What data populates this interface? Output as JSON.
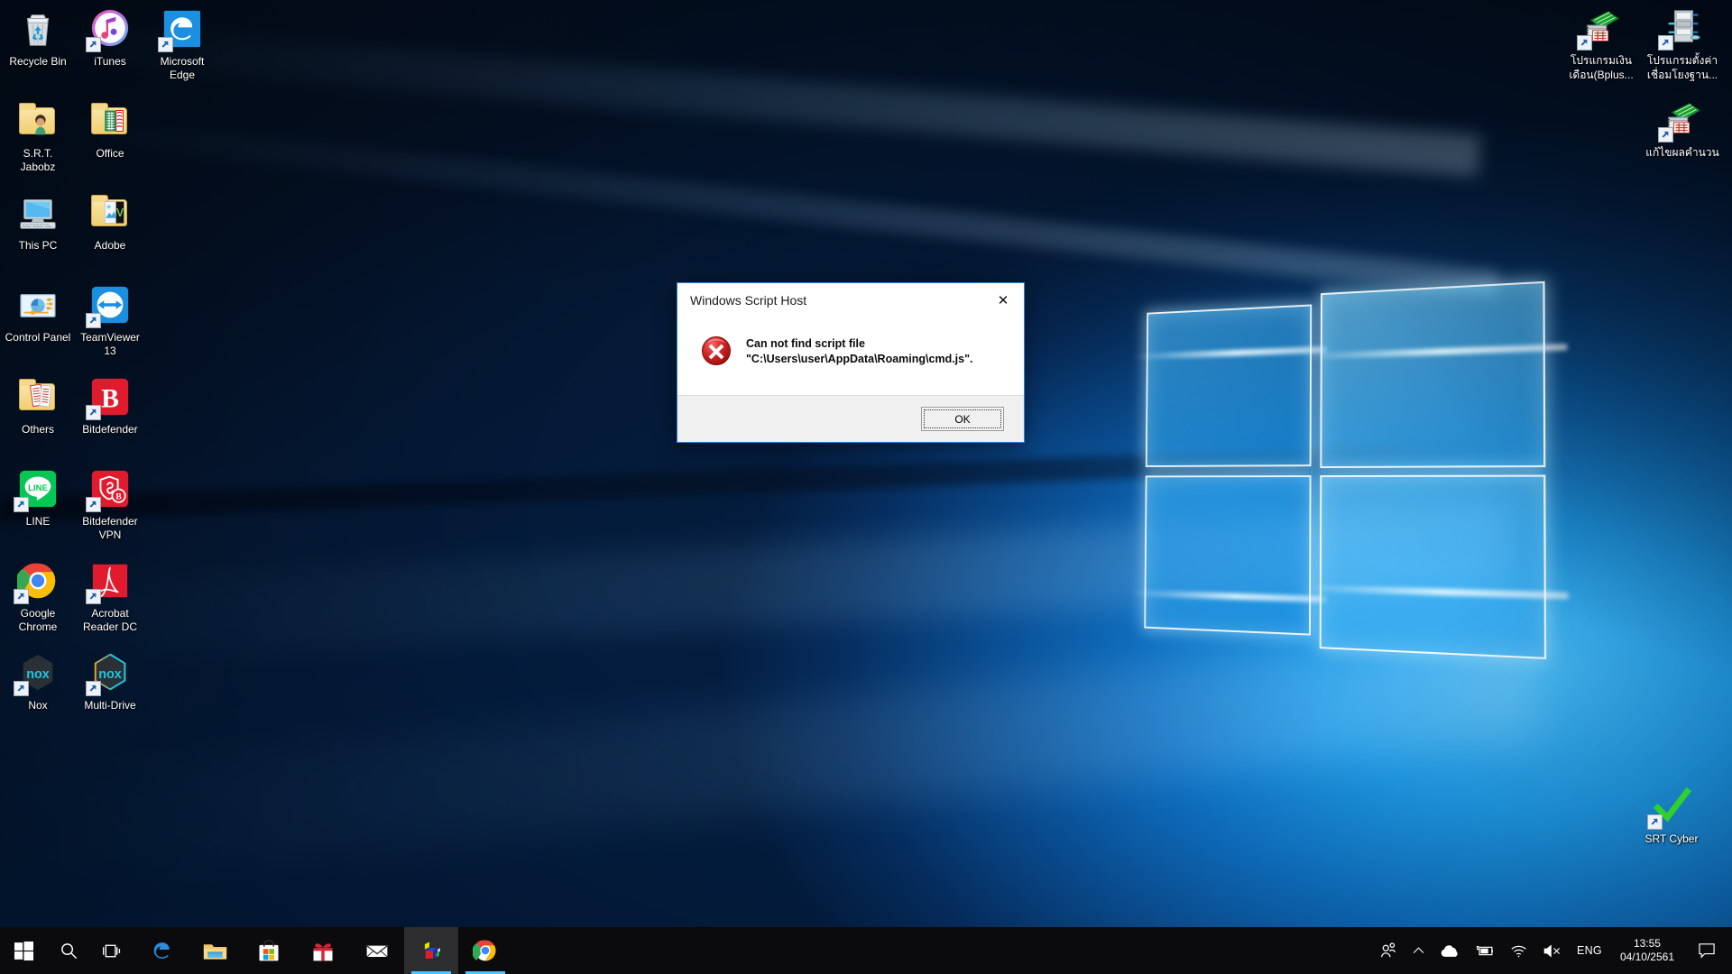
{
  "desktop": {
    "icons_left": [
      {
        "label": "Recycle Bin",
        "icon": "recycle-bin-icon",
        "shortcut": false
      },
      {
        "label": "iTunes",
        "icon": "itunes-icon",
        "shortcut": true
      },
      {
        "label": "Microsoft Edge",
        "icon": "microsoft-edge-icon",
        "shortcut": true
      },
      {
        "label": "S.R.T. Jabobz",
        "icon": "user-folder-icon",
        "shortcut": false
      },
      {
        "label": "Office",
        "icon": "office-folder-icon",
        "shortcut": false
      },
      {
        "label": "This PC",
        "icon": "this-pc-icon",
        "shortcut": false
      },
      {
        "label": "Adobe",
        "icon": "adobe-folder-icon",
        "shortcut": false
      },
      {
        "label": "Control Panel",
        "icon": "control-panel-icon",
        "shortcut": false
      },
      {
        "label": "TeamViewer 13",
        "icon": "teamviewer-icon",
        "shortcut": true
      },
      {
        "label": "Others",
        "icon": "others-folder-icon",
        "shortcut": false
      },
      {
        "label": "Bitdefender",
        "icon": "bitdefender-icon",
        "shortcut": true
      },
      {
        "label": "LINE",
        "icon": "line-icon",
        "shortcut": true
      },
      {
        "label": "Bitdefender VPN",
        "icon": "bitdefender-vpn-icon",
        "shortcut": true
      },
      {
        "label": "Google Chrome",
        "icon": "google-chrome-icon",
        "shortcut": true
      },
      {
        "label": "Acrobat Reader DC",
        "icon": "acrobat-reader-icon",
        "shortcut": true
      },
      {
        "label": "Nox",
        "icon": "nox-icon",
        "shortcut": true
      },
      {
        "label": "Multi-Drive",
        "icon": "nox-multidrive-icon",
        "shortcut": true
      }
    ],
    "icons_right": [
      {
        "label": "โปรแกรมเงินเดือน(Bplus...",
        "icon": "payroll-program-icon",
        "shortcut": true
      },
      {
        "label": "โปรแกรมตั้งค่าเชื่อมโยงฐาน...",
        "icon": "db-link-setup-icon",
        "shortcut": true
      },
      {
        "label": "แก้ไขผลคำนวน",
        "icon": "edit-calculation-icon",
        "shortcut": true
      },
      {
        "label": "SRT Cyber",
        "icon": "srt-cyber-checkmark-icon",
        "shortcut": true
      }
    ]
  },
  "dialog": {
    "title": "Windows Script Host",
    "close_label": "✕",
    "icon": "error-icon",
    "message_line1": "Can not find script file",
    "message_line2": "\"C:\\Users\\user\\AppData\\Roaming\\cmd.js\".",
    "ok_label": "OK"
  },
  "taskbar": {
    "start_label": "Start",
    "items": [
      {
        "name": "start-button",
        "icon": "windows-logo-icon",
        "label": "Start"
      },
      {
        "name": "search-button",
        "icon": "search-icon",
        "label": "Search"
      },
      {
        "name": "task-view-button",
        "icon": "task-view-icon",
        "label": "Task View"
      },
      {
        "name": "taskbar-app-edge",
        "icon": "microsoft-edge-icon",
        "label": "Microsoft Edge"
      },
      {
        "name": "taskbar-app-file-explorer",
        "icon": "file-explorer-icon",
        "label": "File Explorer"
      },
      {
        "name": "taskbar-app-microsoft-store",
        "icon": "microsoft-store-icon",
        "label": "Microsoft Store"
      },
      {
        "name": "taskbar-app-gift",
        "icon": "gift-icon",
        "label": "Gift"
      },
      {
        "name": "taskbar-app-mail",
        "icon": "mail-icon",
        "label": "Mail"
      },
      {
        "name": "taskbar-app-windows-script-host",
        "icon": "wscript-icon",
        "label": "Windows Script Host"
      },
      {
        "name": "taskbar-app-chrome",
        "icon": "google-chrome-icon",
        "label": "Google Chrome"
      }
    ],
    "tray": {
      "people_label": "People",
      "show_hidden_label": "Show hidden icons",
      "onedrive_label": "OneDrive",
      "battery_label": "Battery charging",
      "network_label": "Network",
      "volume_label": "Volume muted",
      "language": "ENG",
      "time": "13:55",
      "date": "04/10/2561",
      "action_center_label": "Action Center"
    }
  },
  "colors": {
    "accent": "#0078d7",
    "taskbar_bg": "#0b0b0d",
    "error_red": "#cc2026",
    "dialog_border": "#2f7fd0",
    "highlight_blue": "#4cc2ff"
  }
}
